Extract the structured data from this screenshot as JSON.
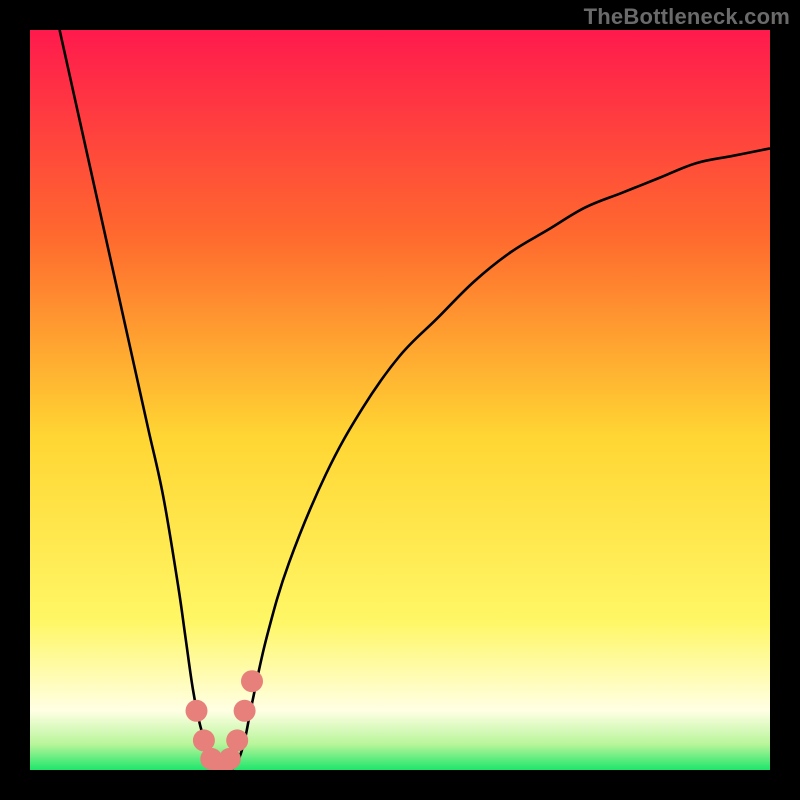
{
  "watermark": "TheBottleneck.com",
  "colors": {
    "top": "#ff1a4d",
    "mid_upper": "#ff6a2e",
    "mid": "#ffd633",
    "mid_lower": "#fff766",
    "pale": "#ffffe4",
    "green": "#1ee66b",
    "marker_fill": "#e77f7b",
    "curve": "#000000",
    "frame": "#000000"
  },
  "chart_data": {
    "type": "line",
    "title": "",
    "xlabel": "",
    "ylabel": "",
    "xlim": [
      0,
      100
    ],
    "ylim": [
      0,
      100
    ],
    "series": [
      {
        "name": "bottleneck-curve",
        "x": [
          4,
          6,
          8,
          10,
          12,
          14,
          16,
          18,
          20,
          21,
          22,
          23,
          24,
          25,
          26,
          27,
          28,
          29,
          30,
          32,
          35,
          40,
          45,
          50,
          55,
          60,
          65,
          70,
          75,
          80,
          85,
          90,
          95,
          100
        ],
        "y": [
          100,
          91,
          82,
          73,
          64,
          55,
          46,
          37,
          25,
          18,
          11,
          6,
          3,
          1,
          0,
          0,
          1,
          4,
          9,
          18,
          28,
          40,
          49,
          56,
          61,
          66,
          70,
          73,
          76,
          78,
          80,
          82,
          83,
          84
        ]
      }
    ],
    "markers": {
      "name": "highlight-points",
      "x": [
        22.5,
        23.5,
        24.5,
        26.0,
        27.0,
        28.0,
        29.0,
        30.0
      ],
      "y": [
        8,
        4,
        1.5,
        0.5,
        1.5,
        4,
        8,
        12
      ]
    },
    "gradient_stops": [
      {
        "offset": 0.0,
        "color": "#ff1a4d"
      },
      {
        "offset": 0.28,
        "color": "#ff6a2e"
      },
      {
        "offset": 0.55,
        "color": "#ffd633"
      },
      {
        "offset": 0.8,
        "color": "#fff766"
      },
      {
        "offset": 0.92,
        "color": "#ffffe4"
      },
      {
        "offset": 0.965,
        "color": "#b8f59a"
      },
      {
        "offset": 1.0,
        "color": "#1ee66b"
      }
    ]
  }
}
